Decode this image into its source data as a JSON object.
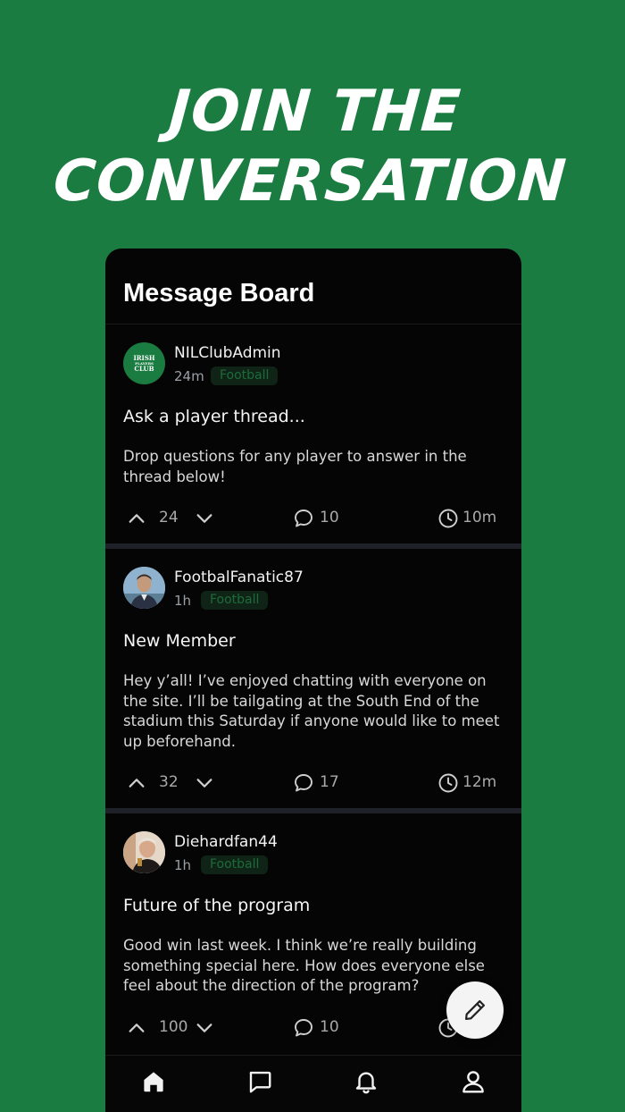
{
  "promo": {
    "line1": "JOIN THE",
    "line2": "CONVERSATION"
  },
  "board": {
    "title": "Message Board"
  },
  "posts": [
    {
      "author": "NILClubAdmin",
      "avatar": {
        "kind": "logo",
        "line1": "IRISH",
        "line2": "PLAYERS",
        "line3": "CLUB"
      },
      "age": "24m",
      "tag": "Football",
      "title": "Ask a player thread...",
      "body": "Drop questions for any player to answer in the thread below!",
      "votes": "24",
      "comments": "10",
      "time": "10m"
    },
    {
      "author": "FootbalFanatic87",
      "avatar": {
        "kind": "photo"
      },
      "age": "1h",
      "tag": "Football",
      "title": "New Member",
      "body": "Hey y’all! I’ve enjoyed chatting with everyone on the site. I’ll be tailgating at the South End of the stadium this Saturday if anyone would like to meet up beforehand.",
      "votes": "32",
      "comments": "17",
      "time": "12m"
    },
    {
      "author": "Diehardfan44",
      "avatar": {
        "kind": "photo"
      },
      "age": "1h",
      "tag": "Football",
      "title": "Future of the program",
      "body": "Good win last week. I think we’re really building something special here. How does everyone else feel about the direction of the program?",
      "votes": "100",
      "comments": "10",
      "time": ""
    }
  ],
  "icons": {
    "upvote": "chevron-up-icon",
    "downvote": "chevron-down-icon",
    "comment": "speech-bubble-icon",
    "time": "clock-icon",
    "compose": "pencil-icon",
    "tabs": [
      "home-icon",
      "chat-icon",
      "bell-icon",
      "user-icon"
    ]
  },
  "colors": {
    "background": "#1a7c41",
    "card": "#050505",
    "tag_text": "#1d6b3a",
    "tag_bg": "#0f2417"
  }
}
